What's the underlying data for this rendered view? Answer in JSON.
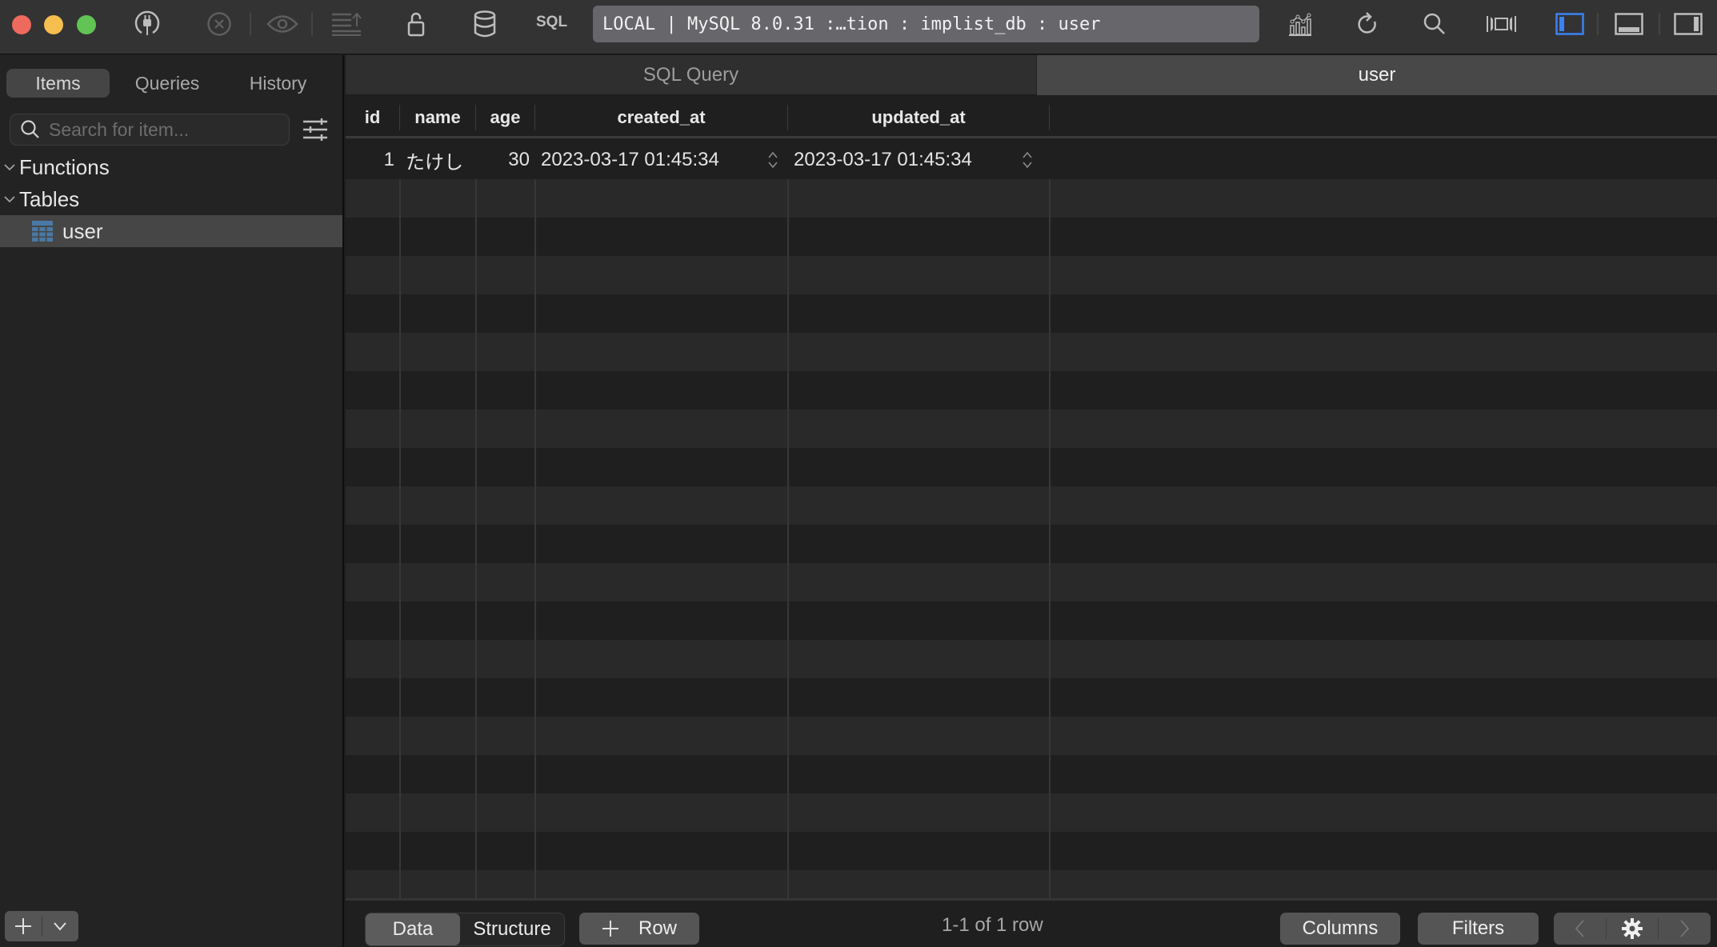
{
  "window": {
    "connection_label": "LOCAL | MySQL 8.0.31 :…tion : implist_db : user",
    "toolbar": {
      "sql_label": "SQL",
      "icons": [
        "connect-plug-icon",
        "stop-icon",
        "preview-eye-icon",
        "commit-changes-icon",
        "lock-icon",
        "database-icon",
        "sql-icon",
        "metrics-chart-icon",
        "refresh-icon",
        "search-icon",
        "split-view-icon",
        "toggle-left-sidebar-icon",
        "toggle-bottom-panel-icon",
        "toggle-right-sidebar-icon"
      ]
    }
  },
  "sidebar": {
    "segments": [
      {
        "label": "Items",
        "active": true
      },
      {
        "label": "Queries",
        "active": false
      },
      {
        "label": "History",
        "active": false
      }
    ],
    "search": {
      "placeholder": "Search for item...",
      "value": ""
    },
    "tree": [
      {
        "label": "Functions",
        "expanded": true
      },
      {
        "label": "Tables",
        "expanded": true
      }
    ],
    "tables": [
      {
        "label": "user",
        "selected": true
      }
    ]
  },
  "tabs": [
    {
      "label": "SQL Query",
      "active": false
    },
    {
      "label": "user",
      "active": true
    }
  ],
  "table": {
    "columns": [
      "id",
      "name",
      "age",
      "created_at",
      "updated_at"
    ],
    "rows": [
      {
        "id": "1",
        "name": "たけし",
        "age": "30",
        "created_at": "2023-03-17 01:45:34",
        "updated_at": "2023-03-17 01:45:34"
      }
    ]
  },
  "bottombar": {
    "view_modes": [
      {
        "label": "Data",
        "active": true
      },
      {
        "label": "Structure",
        "active": false
      }
    ],
    "add_row_label": "Row",
    "row_count": "1-1 of 1 row",
    "columns_label": "Columns",
    "filters_label": "Filters"
  },
  "colors": {
    "accent": "#3b82f6",
    "table_icon": "#4a79a5"
  }
}
